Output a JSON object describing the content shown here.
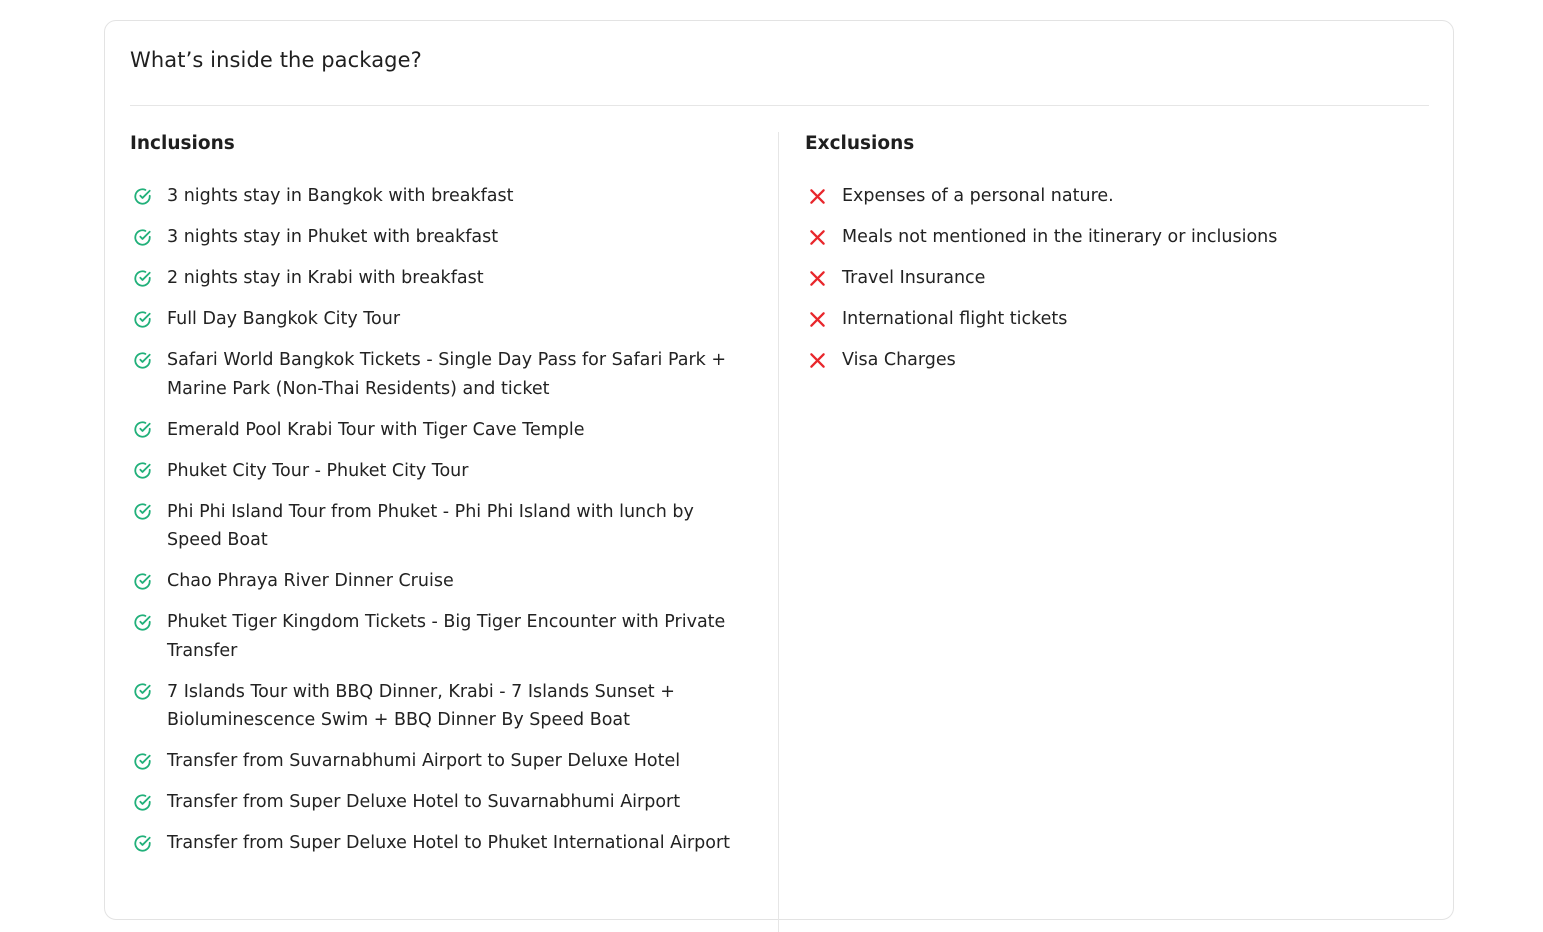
{
  "title": "What’s inside the package?",
  "colors": {
    "check": "#21b07a",
    "cross": "#e8262b",
    "border": "#e3e3e3"
  },
  "icons": {
    "inclusion": "check-circle-icon",
    "exclusion": "cross-icon"
  },
  "inclusions": {
    "heading": "Inclusions",
    "items": [
      "3 nights stay in Bangkok with breakfast",
      "3 nights stay in Phuket with breakfast",
      "2 nights stay in Krabi with breakfast",
      "Full Day Bangkok City Tour",
      "Safari World Bangkok Tickets - Single Day Pass for Safari Park + Marine Park (Non-Thai Residents) and ticket",
      "Emerald Pool Krabi Tour with Tiger Cave Temple",
      "Phuket City Tour - Phuket City Tour",
      "Phi Phi Island Tour from Phuket - Phi Phi Island with lunch by Speed Boat",
      "Chao Phraya River Dinner Cruise",
      "Phuket Tiger Kingdom Tickets - Big Tiger Encounter with Private Transfer",
      "7 Islands Tour with BBQ Dinner, Krabi - 7 Islands Sunset + Bioluminescence Swim + BBQ Dinner By Speed Boat",
      "Transfer from Suvarnabhumi Airport to Super Deluxe Hotel",
      "Transfer from Super Deluxe Hotel to Suvarnabhumi Airport",
      "Transfer from Super Deluxe Hotel to Phuket International Airport"
    ]
  },
  "exclusions": {
    "heading": "Exclusions",
    "items": [
      "Expenses of a personal nature.",
      "Meals not mentioned in the itinerary or inclusions",
      "Travel Insurance",
      "International flight tickets",
      "Visa Charges"
    ]
  }
}
